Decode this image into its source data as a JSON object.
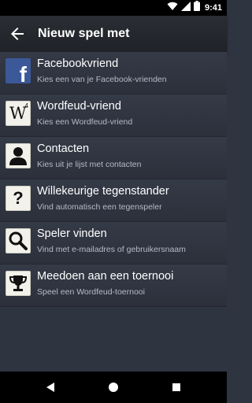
{
  "status_bar": {
    "time": "9:41",
    "icons": [
      "wifi-icon",
      "signal-icon",
      "battery-icon"
    ]
  },
  "app_bar": {
    "title": "Nieuw spel met",
    "back_icon": "back-arrow-icon"
  },
  "list": {
    "items": [
      {
        "title": "Facebookvriend",
        "subtitle": "Kies een van je Facebook-vrienden",
        "icon": "facebook-icon"
      },
      {
        "title": "Wordfeud-vriend",
        "subtitle": "Kies een Wordfeud-vriend",
        "icon": "wordfeud-tile-icon"
      },
      {
        "title": "Contacten",
        "subtitle": "Kies uit je lijst met contacten",
        "icon": "contact-person-icon"
      },
      {
        "title": "Willekeurige tegenstander",
        "subtitle": "Vind automatisch een tegenspeler",
        "icon": "question-mark-icon"
      },
      {
        "title": "Speler vinden",
        "subtitle": "Vind met e-mailadres of gebruikersnaam",
        "icon": "magnifier-icon"
      },
      {
        "title": "Meedoen aan een toernooi",
        "subtitle": "Speel een Wordfeud-toernooi",
        "icon": "trophy-icon"
      }
    ]
  },
  "icon_text": {
    "facebook": "f",
    "wordfeud_letter": "W",
    "wordfeud_score": "4",
    "question": "?"
  },
  "nav_bar": {
    "buttons": [
      "back-triangle-icon",
      "home-circle-icon",
      "recents-square-icon"
    ]
  },
  "colors": {
    "background": "#2f3441",
    "app_bar": "#24272d",
    "status_bar": "#000000",
    "title_text": "#ffffff",
    "subtitle_text": "#b5bac6",
    "facebook_blue": "#3b5998"
  }
}
